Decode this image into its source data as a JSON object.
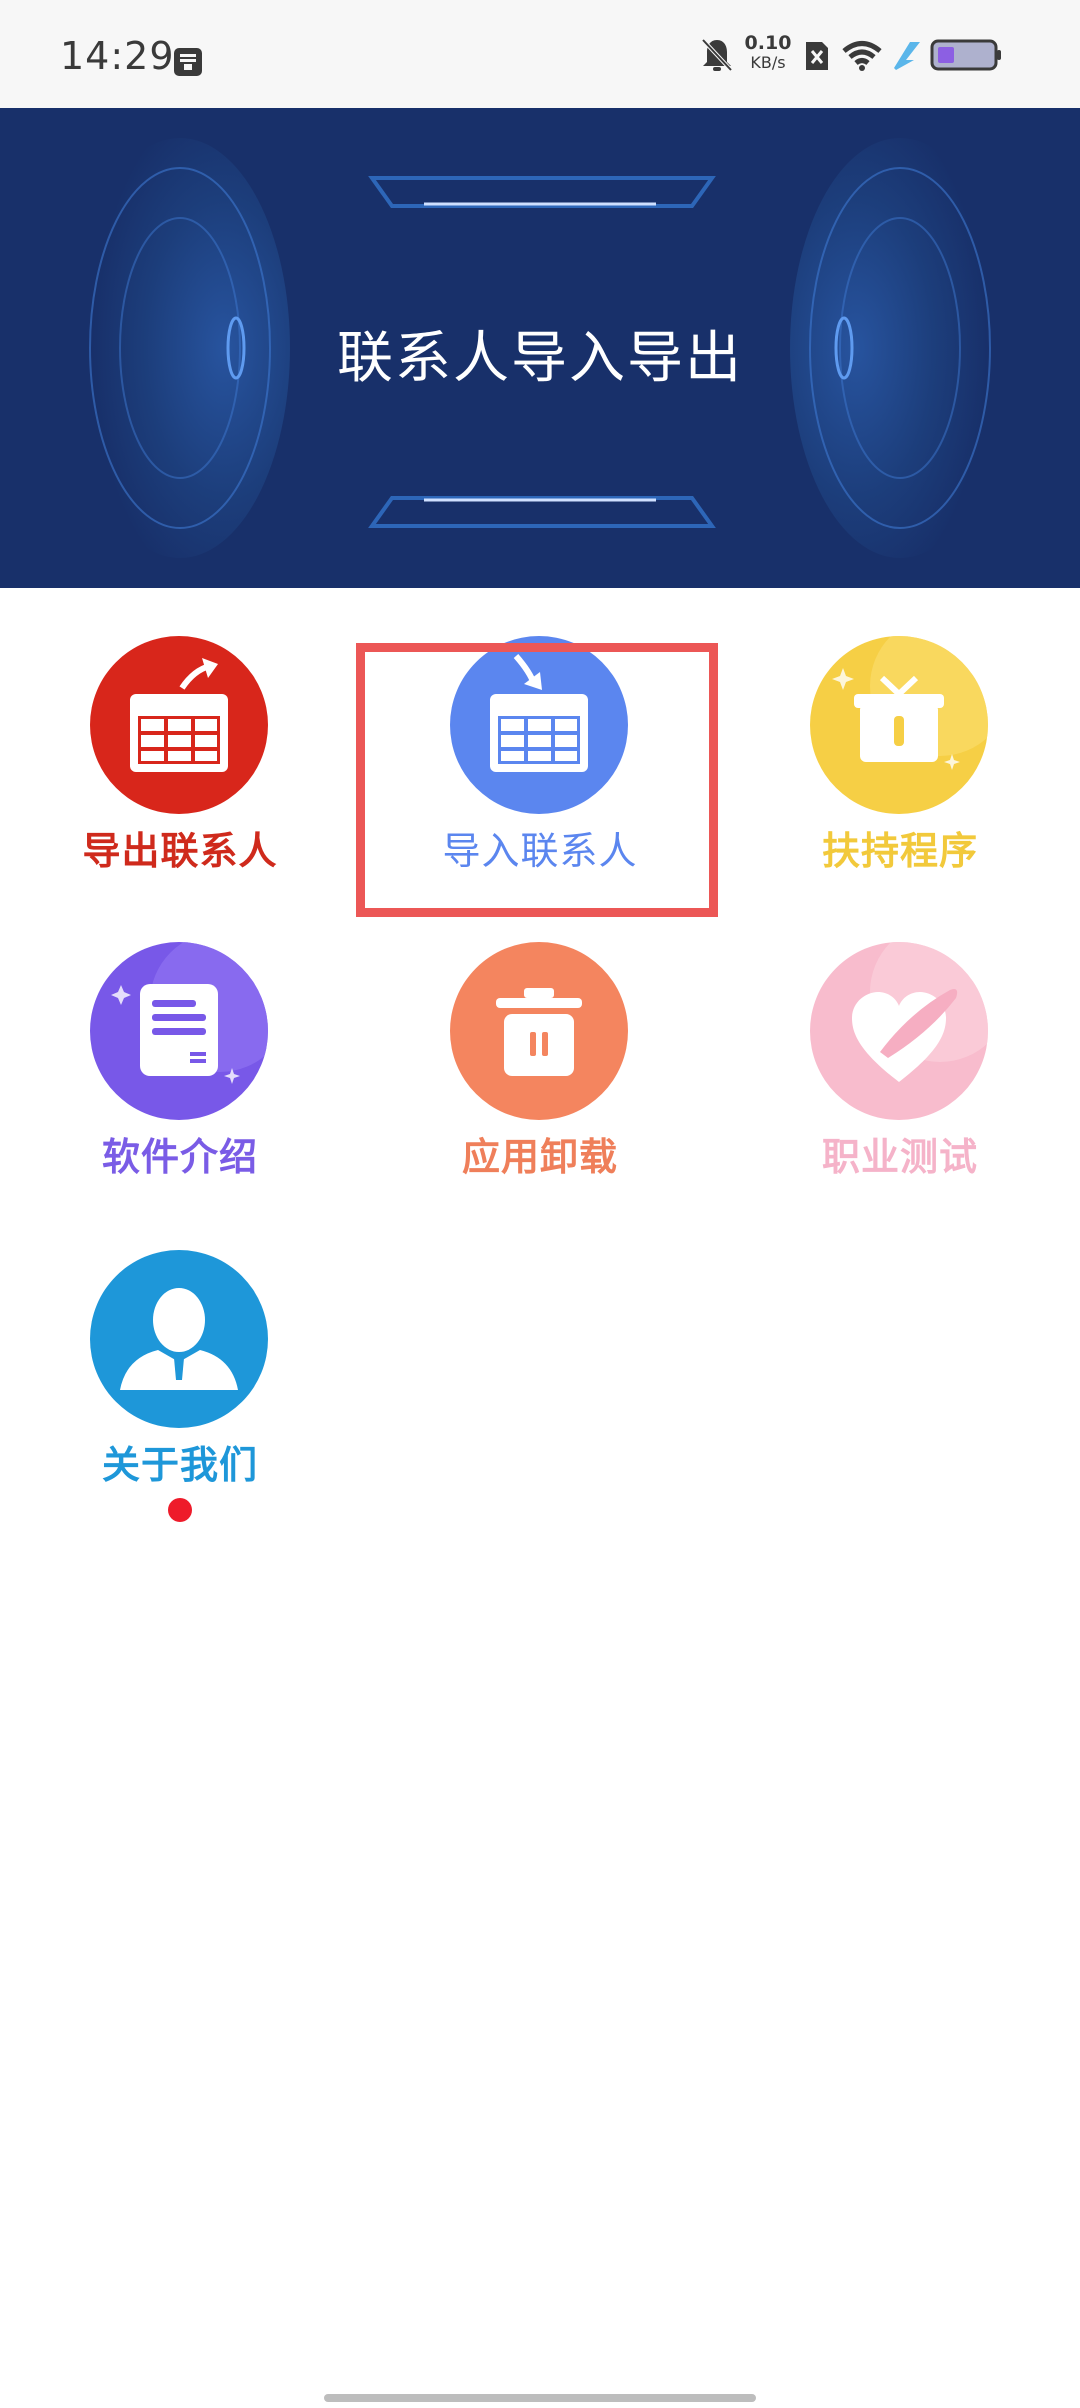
{
  "status_bar": {
    "time": "14:29",
    "speed_value": "0.10",
    "speed_unit": "KB/s",
    "icons": [
      "screen-record-icon",
      "bell-mute-icon",
      "sim-x-icon",
      "wifi-icon",
      "charging-bolt-icon",
      "battery-icon"
    ]
  },
  "banner": {
    "title": "联系人导入导出"
  },
  "grid": {
    "items": [
      {
        "label": "导出联系人",
        "color": "#cf2a1c",
        "icon": "export-contacts-icon"
      },
      {
        "label": "导入联系人",
        "color": "#5b86ef",
        "icon": "import-contacts-icon"
      },
      {
        "label": "扶持程序",
        "color": "#f2c93b",
        "icon": "gift-box-icon"
      },
      {
        "label": "软件介绍",
        "color": "#7a5ce6",
        "icon": "document-icon"
      },
      {
        "label": "应用卸载",
        "color": "#ef7f5a",
        "icon": "trash-icon"
      },
      {
        "label": "职业测试",
        "color": "#f5b3c9",
        "icon": "heart-icon"
      },
      {
        "label": "关于我们",
        "color": "#1e97d9",
        "icon": "user-profile-icon"
      }
    ]
  },
  "colors": {
    "banner_bg": "#18306a",
    "highlight_border": "#ec5756",
    "badge_dot": "#ee1b2a"
  }
}
